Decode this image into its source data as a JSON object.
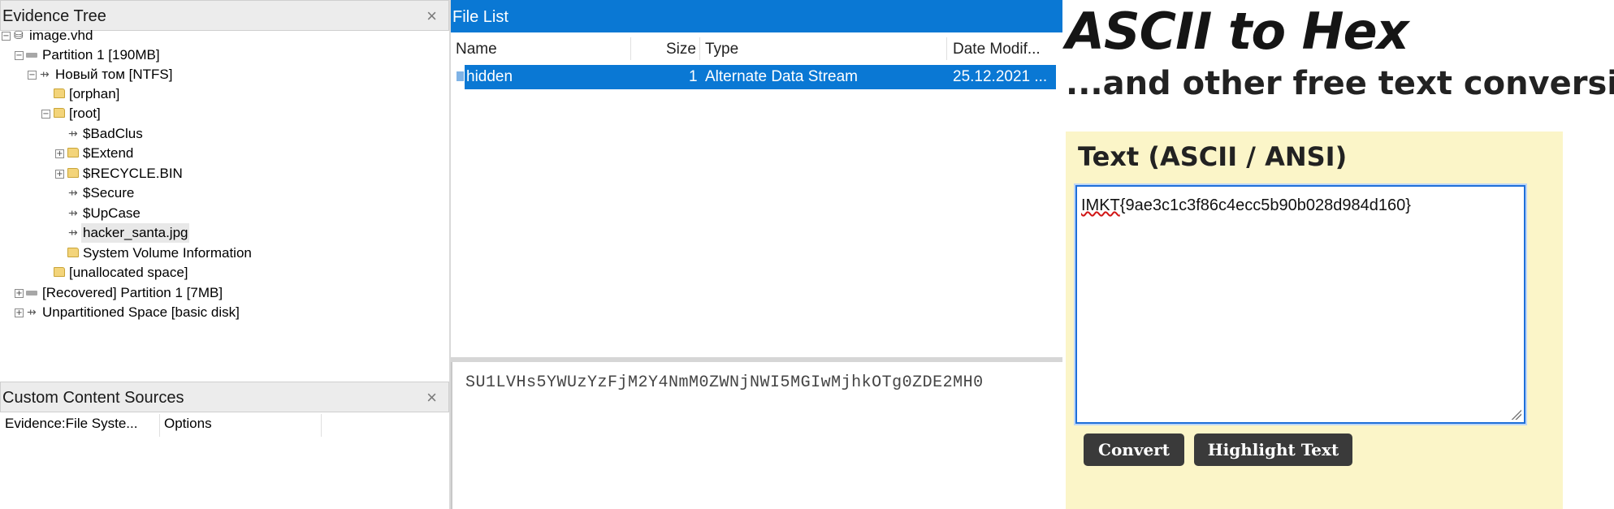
{
  "evidence_tree": {
    "title": "Evidence Tree",
    "close_glyph": "×",
    "items": [
      {
        "label": "image.vhd",
        "icon": "disk-image-icon"
      },
      {
        "label": "Partition 1 [190MB]",
        "icon": "partition-icon"
      },
      {
        "label": "Новый том [NTFS]",
        "icon": "volume-icon"
      },
      {
        "label": "[orphan]",
        "icon": "folder-icon"
      },
      {
        "label": "[root]",
        "icon": "folder-icon"
      },
      {
        "label": "$BadClus",
        "icon": "file-icon"
      },
      {
        "label": "$Extend",
        "icon": "folder-icon"
      },
      {
        "label": "$RECYCLE.BIN",
        "icon": "folder-icon"
      },
      {
        "label": "$Secure",
        "icon": "file-icon"
      },
      {
        "label": "$UpCase",
        "icon": "file-icon"
      },
      {
        "label": "hacker_santa.jpg",
        "icon": "file-icon"
      },
      {
        "label": "System Volume Information",
        "icon": "folder-icon"
      },
      {
        "label": "[unallocated space]",
        "icon": "folder-icon"
      },
      {
        "label": "[Recovered] Partition 1 [7MB]",
        "icon": "partition-icon"
      },
      {
        "label": "Unpartitioned Space [basic disk]",
        "icon": "volume-icon"
      }
    ]
  },
  "custom_content_sources": {
    "title": "Custom Content Sources",
    "close_glyph": "×",
    "columns": [
      "Evidence:File Syste...",
      "Options"
    ]
  },
  "file_list": {
    "title": "File List",
    "columns": [
      "Name",
      "Size",
      "Type",
      "Date Modif..."
    ],
    "rows": [
      {
        "name": "hidden",
        "size": "1",
        "type": "Alternate Data Stream",
        "date": "25.12.2021 ..."
      }
    ]
  },
  "hex_viewer": {
    "text": "SU1LVHs5YWUzYzFjM2Y4NmM0ZWNjNWI5MGIwMjhkOTg0ZDE2MH0"
  },
  "converter": {
    "site_title": "ASCII to Hex",
    "site_subtitle": "...and other free text conversion",
    "input_label": "Text (ASCII / ANSI)",
    "input_prefix": "IMKT",
    "input_rest": "{9ae3c1c3f86c4ecc5b90b028d984d160}",
    "convert_label": "Convert",
    "highlight_label": "Highlight Text"
  },
  "colors": {
    "selection": "#0a78d4",
    "panel_background": "#fbf5c8",
    "button": "#3a3a3a"
  }
}
